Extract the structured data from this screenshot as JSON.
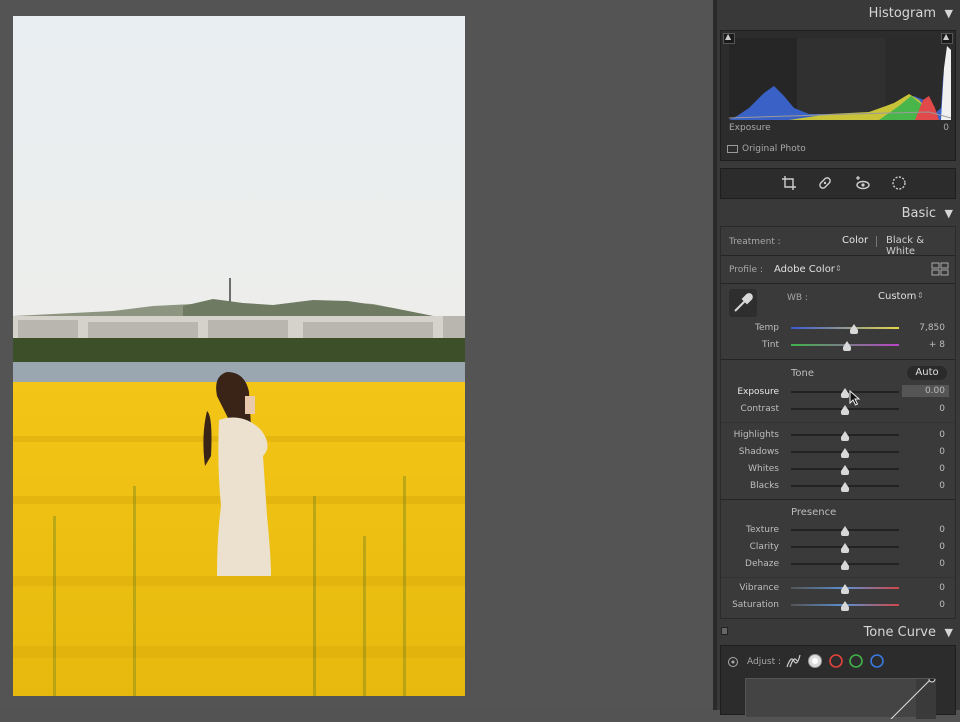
{
  "histogram": {
    "title": "Histogram",
    "readout_label": "Exposure",
    "readout_value": "0",
    "original_photo_label": "Original Photo"
  },
  "basic": {
    "title": "Basic",
    "treatment_label": "Treatment :",
    "treatment_color": "Color",
    "treatment_bw": "Black & White",
    "profile_label": "Profile :",
    "profile_value": "Adobe Color",
    "wb_label": "WB :",
    "wb_value": "Custom",
    "temp": {
      "label": "Temp",
      "value": "7,850",
      "level": 0.58
    },
    "tint": {
      "label": "Tint",
      "value": "+ 8",
      "level": 0.52
    },
    "tone_title": "Tone",
    "auto_label": "Auto",
    "exposure": {
      "label": "Exposure",
      "value": "0.00",
      "level": 0.5
    },
    "contrast": {
      "label": "Contrast",
      "value": "0",
      "level": 0.5
    },
    "highlights": {
      "label": "Highlights",
      "value": "0",
      "level": 0.5
    },
    "shadows": {
      "label": "Shadows",
      "value": "0",
      "level": 0.5
    },
    "whites": {
      "label": "Whites",
      "value": "0",
      "level": 0.5
    },
    "blacks": {
      "label": "Blacks",
      "value": "0",
      "level": 0.5
    },
    "presence_title": "Presence",
    "texture": {
      "label": "Texture",
      "value": "0",
      "level": 0.5
    },
    "clarity": {
      "label": "Clarity",
      "value": "0",
      "level": 0.5
    },
    "dehaze": {
      "label": "Dehaze",
      "value": "0",
      "level": 0.5
    },
    "vibrance": {
      "label": "Vibrance",
      "value": "0",
      "level": 0.5
    },
    "saturation": {
      "label": "Saturation",
      "value": "0",
      "level": 0.5
    }
  },
  "tone_curve": {
    "title": "Tone Curve",
    "adjust_label": "Adjust :"
  },
  "colors": {
    "panel_bg": "#393939",
    "canvas_bg": "#545454",
    "text": "#cfcfcf"
  }
}
